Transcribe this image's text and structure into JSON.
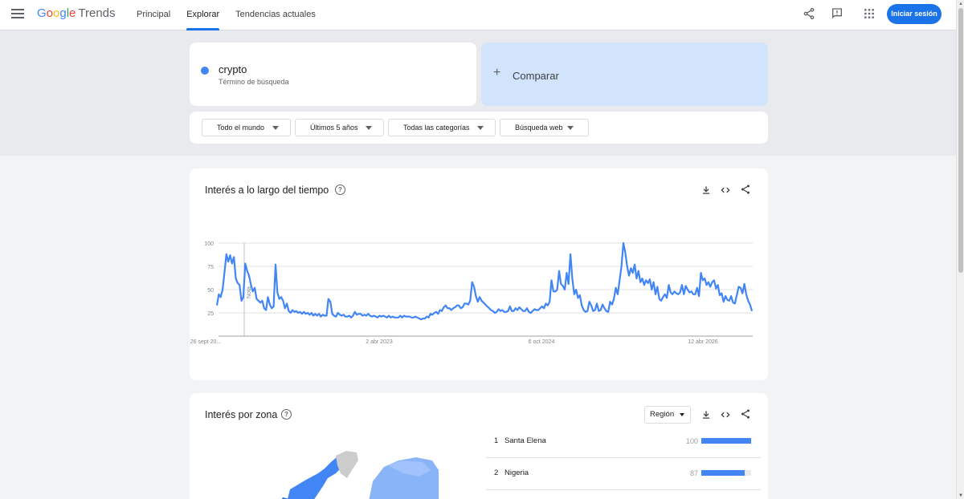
{
  "header": {
    "logo_google": "Google",
    "logo_trends": "Trends",
    "nav": [
      {
        "label": "Principal",
        "active": false
      },
      {
        "label": "Explorar",
        "active": true
      },
      {
        "label": "Tendencias actuales",
        "active": false
      }
    ],
    "icons": [
      "share-icon",
      "feedback-icon",
      "apps-grid-icon"
    ],
    "signin_label": "Iniciar sesión",
    "accent_color": "#1a73e8"
  },
  "search": {
    "term": "crypto",
    "term_type": "Término de búsqueda",
    "term_color": "#4285f4",
    "compare_label": "Comparar"
  },
  "filters": {
    "region": "Todo el mundo",
    "period": "Últimos 5 años",
    "category": "Todas las categorías",
    "search_type": "Búsqueda web"
  },
  "interest_over_time": {
    "title": "Interés a lo largo del tiempo",
    "tools": [
      "download-icon",
      "embed-icon",
      "share-icon"
    ]
  },
  "chart_data": {
    "type": "line",
    "ylim": [
      0,
      100
    ],
    "yticks": [
      25,
      50,
      75,
      100
    ],
    "xtick_labels": [
      "26 sept 20...",
      "2 abr 2023",
      "6 oct 2024",
      "12 abr 2026"
    ],
    "annotation": "Nota",
    "grid": true,
    "series": [
      {
        "color": "#4285f4",
        "values": [
          33,
          45,
          42,
          50,
          68,
          88,
          80,
          87,
          78,
          85,
          62,
          57,
          55,
          38,
          42,
          78,
          70,
          65,
          55,
          48,
          52,
          40,
          38,
          36,
          38,
          30,
          28,
          42,
          34,
          30,
          32,
          77,
          47,
          40,
          42,
          38,
          30,
          35,
          27,
          25,
          28,
          26,
          27,
          25,
          26,
          24,
          26,
          24,
          25,
          23,
          25,
          22,
          24,
          22,
          24,
          21,
          23,
          22,
          22,
          40,
          37,
          24,
          22,
          21,
          25,
          23,
          22,
          23,
          21,
          21,
          22,
          20,
          22,
          26,
          23,
          24,
          24,
          22,
          23,
          22,
          24,
          22,
          21,
          22,
          21,
          20,
          22,
          21,
          22,
          21,
          20,
          22,
          20,
          21,
          20,
          20,
          20,
          22,
          20,
          22,
          21,
          21,
          21,
          20,
          20,
          21,
          20,
          19,
          18,
          19,
          19,
          21,
          20,
          24,
          23,
          25,
          26,
          24,
          28,
          27,
          31,
          33,
          30,
          30,
          28,
          30,
          31,
          33,
          33,
          30,
          31,
          35,
          35,
          34,
          38,
          58,
          53,
          43,
          37,
          42,
          38,
          36,
          34,
          32,
          30,
          28,
          27,
          25,
          26,
          29,
          27,
          28,
          26,
          26,
          27,
          32,
          27,
          27,
          30,
          28,
          31,
          29,
          27,
          27,
          30,
          26,
          25,
          27,
          29,
          28,
          28,
          30,
          32,
          30,
          35,
          33,
          37,
          60,
          48,
          48,
          50,
          70,
          56,
          54,
          50,
          68,
          56,
          88,
          62,
          45,
          50,
          41,
          44,
          33,
          28,
          26,
          27,
          37,
          33,
          27,
          28,
          35,
          27,
          28,
          34,
          30,
          27,
          26,
          37,
          34,
          40,
          52,
          45,
          60,
          75,
          100,
          90,
          75,
          65,
          73,
          68,
          77,
          62,
          70,
          58,
          62,
          55,
          60,
          57,
          61,
          50,
          58,
          45,
          53,
          40,
          38,
          42,
          45,
          41,
          55,
          47,
          45,
          48,
          46,
          45,
          47,
          55,
          45,
          54,
          50,
          47,
          48,
          45,
          45,
          52,
          43,
          68,
          60,
          62,
          55,
          58,
          53,
          58,
          60,
          51,
          55,
          44,
          46,
          37,
          43,
          39,
          38,
          43,
          36,
          35,
          44,
          53,
          52,
          46,
          56,
          45,
          38,
          34,
          27
        ]
      }
    ]
  },
  "interest_by_region": {
    "title": "Interés por zona",
    "region_select": "Región",
    "tools": [
      "download-icon",
      "embed-icon",
      "share-icon"
    ],
    "rows": [
      {
        "rank": "1",
        "name": "Santa Elena",
        "value": "100",
        "fraction": 1.0
      },
      {
        "rank": "2",
        "name": "Nigeria",
        "value": "87",
        "fraction": 0.87
      }
    ]
  }
}
